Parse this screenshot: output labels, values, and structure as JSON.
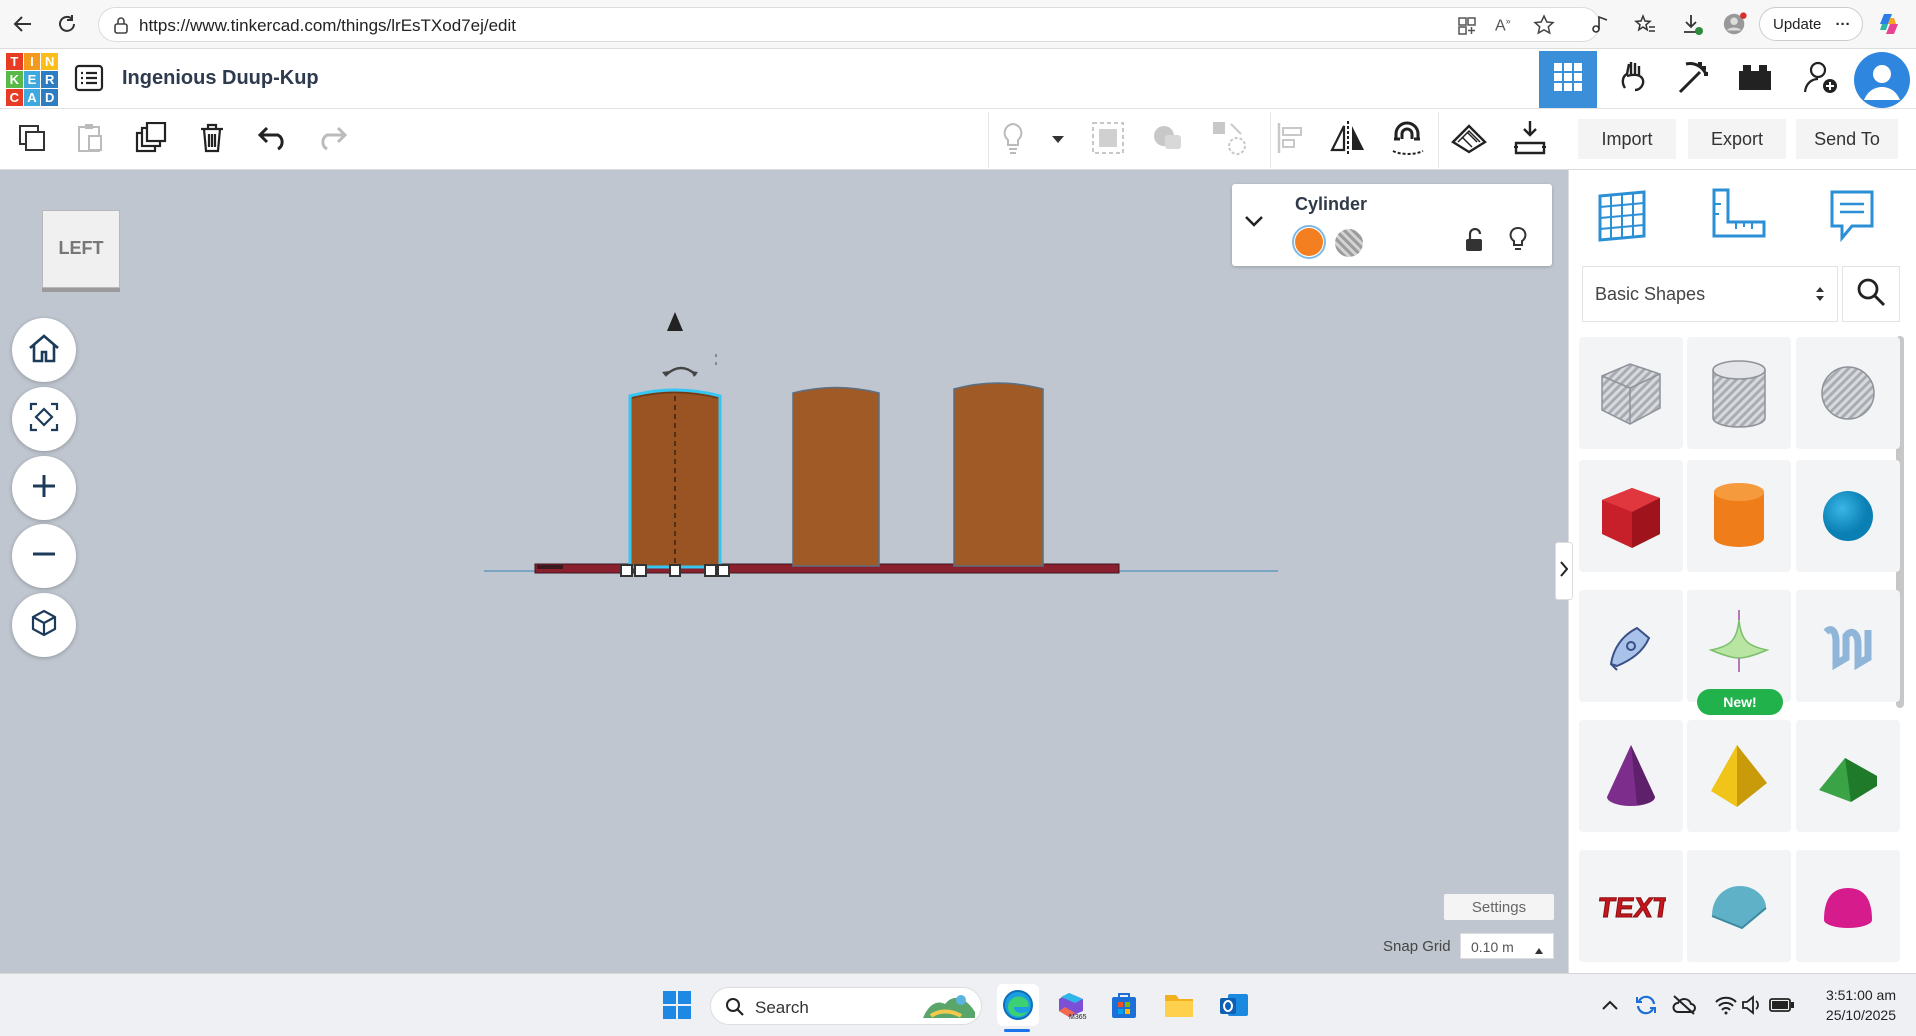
{
  "browser": {
    "url": "https://www.tinkercad.com/things/lrEsTXod7ej/edit",
    "update_label": "Update",
    "more_label": "···"
  },
  "app": {
    "logo_letters": [
      "T",
      "I",
      "N",
      "K",
      "E",
      "R",
      "C",
      "A",
      "D"
    ],
    "logo_colors": [
      "#e83b24",
      "#f39a1e",
      "#fbbd19",
      "#58b948",
      "#3fa9df",
      "#2f7dc1",
      "#e83b24",
      "#3fa9df",
      "#2f7dc1"
    ],
    "title": "Ingenious Duup-Kup"
  },
  "toolbar": {
    "import_label": "Import",
    "export_label": "Export",
    "sendto_label": "Send To"
  },
  "viewcube": {
    "face_label": "LEFT"
  },
  "inspector": {
    "shape_name": "Cylinder",
    "solid_color": "#f47f21",
    "hole_color": "#b5b5b5"
  },
  "scene": {
    "selected_color": "#9a5423",
    "selection_outline": "#35c6f4",
    "cylinder_color": "#a05a26",
    "plate_color": "#8a1f2e",
    "ground_line_color": "#7aa4c2"
  },
  "canvas_footer": {
    "settings_label": "Settings",
    "snap_grid_label": "Snap Grid",
    "snap_grid_value": "0.10 m"
  },
  "shapes_panel": {
    "category": "Basic Shapes",
    "new_badge": "New!",
    "shapes": [
      {
        "name": "box-hole"
      },
      {
        "name": "cylinder-hole"
      },
      {
        "name": "sphere-hole"
      },
      {
        "name": "box"
      },
      {
        "name": "cylinder"
      },
      {
        "name": "sphere"
      },
      {
        "name": "scribble"
      },
      {
        "name": "shape-generator"
      },
      {
        "name": "text-wave"
      },
      {
        "name": "cone"
      },
      {
        "name": "pyramid"
      },
      {
        "name": "roof"
      },
      {
        "name": "text"
      },
      {
        "name": "half-cylinder"
      },
      {
        "name": "paraboloid"
      }
    ]
  },
  "taskbar": {
    "search_label": "Search",
    "time": "3:51:00 am",
    "date": "25/10/2025"
  }
}
